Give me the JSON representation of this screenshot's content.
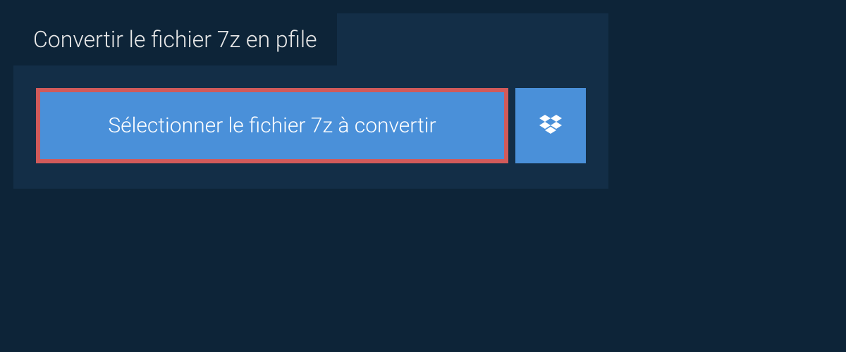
{
  "header": {
    "title": "Convertir le fichier 7z en pfile"
  },
  "upload": {
    "select_label": "Sélectionner le fichier 7z à convertir"
  }
}
